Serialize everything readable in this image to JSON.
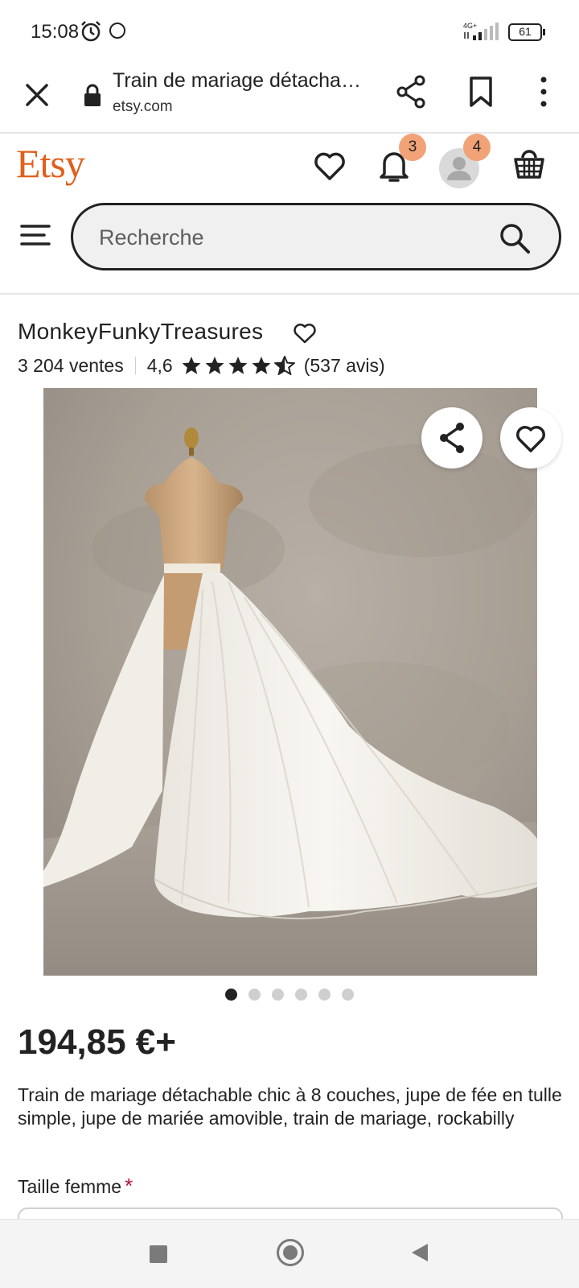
{
  "status_bar": {
    "time": "15:08",
    "network": "4G+",
    "battery": "61"
  },
  "browser": {
    "title": "Train de mariage détachable chic à 8 couches",
    "domain": "etsy.com"
  },
  "etsy": {
    "logo": "Etsy",
    "notifications_count": "3",
    "account_count": "4",
    "search_placeholder": "Recherche",
    "brand_color": "#e0601c",
    "badge_color": "#f1a377"
  },
  "shop": {
    "name": "MonkeyFunkyTreasures",
    "sales": "3 204 ventes",
    "rating": "4,6",
    "rating_stars": 4.5,
    "reviews": "(537 avis)"
  },
  "product": {
    "image_count": 6,
    "active_image": 1,
    "price": "194,85 €+",
    "description": "Train de mariage détachable chic à 8 couches, jupe de fée en tulle simple, jupe de mariée amovible, train de mariage, rockabilly",
    "size_label": "Taille femme",
    "required_marker": "*"
  },
  "icons": {
    "close": "close-icon",
    "lock": "lock-icon",
    "share": "share-icon",
    "bookmark": "bookmark-icon",
    "menu": "more-vertical-icon",
    "favorites": "heart-icon",
    "notifications": "bell-icon",
    "account": "user-icon",
    "cart": "basket-icon",
    "hamburger": "hamburger-icon",
    "search": "search-icon"
  }
}
